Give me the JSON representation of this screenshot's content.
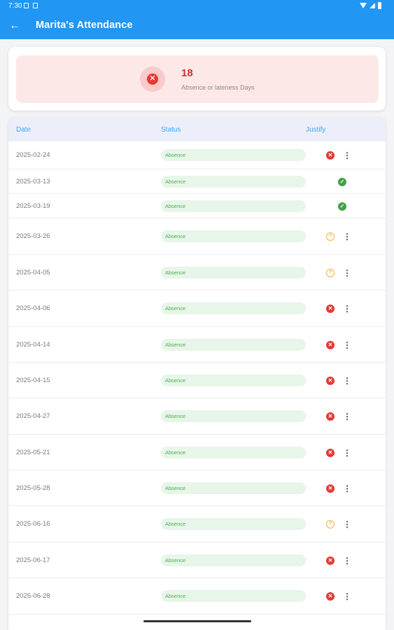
{
  "status_bar": {
    "time": "7:30"
  },
  "app_bar": {
    "back_icon": "arrow-left-icon",
    "title": "Marita's Attendance"
  },
  "summary": {
    "count": "18",
    "label": "Absence or lateness Days",
    "icon": "x-circle-icon",
    "accent_color": "#d32f2f"
  },
  "table": {
    "headers": {
      "date": "Date",
      "status": "Status",
      "justify": "Justify"
    },
    "rows": [
      {
        "date": "2025-02-24",
        "status": "Absence",
        "justify": "rejected",
        "has_menu": true
      },
      {
        "date": "2025-03-13",
        "status": "Absence",
        "justify": "approved",
        "has_menu": false
      },
      {
        "date": "2025-03-19",
        "status": "Absence",
        "justify": "approved",
        "has_menu": false
      },
      {
        "date": "2025-03-26",
        "status": "Absence",
        "justify": "pending",
        "has_menu": true
      },
      {
        "date": "2025-04-05",
        "status": "Absence",
        "justify": "pending",
        "has_menu": true
      },
      {
        "date": "2025-04-06",
        "status": "Absence",
        "justify": "rejected",
        "has_menu": true
      },
      {
        "date": "2025-04-14",
        "status": "Absence",
        "justify": "rejected",
        "has_menu": true
      },
      {
        "date": "2025-04-15",
        "status": "Absence",
        "justify": "rejected",
        "has_menu": true
      },
      {
        "date": "2025-04-27",
        "status": "Absence",
        "justify": "rejected",
        "has_menu": true
      },
      {
        "date": "2025-05-21",
        "status": "Absence",
        "justify": "rejected",
        "has_menu": true
      },
      {
        "date": "2025-05-28",
        "status": "Absence",
        "justify": "rejected",
        "has_menu": true
      },
      {
        "date": "2025-06-16",
        "status": "Absence",
        "justify": "pending",
        "has_menu": true
      },
      {
        "date": "2025-06-17",
        "status": "Absence",
        "justify": "rejected",
        "has_menu": true
      },
      {
        "date": "2025-06-28",
        "status": "Absence",
        "justify": "rejected",
        "has_menu": true
      }
    ]
  },
  "colors": {
    "primary": "#2196f3",
    "absence_green": "#4caf50",
    "rejected_red": "#e53935",
    "approved_green": "#43a047",
    "pending_orange": "#f5b041"
  }
}
